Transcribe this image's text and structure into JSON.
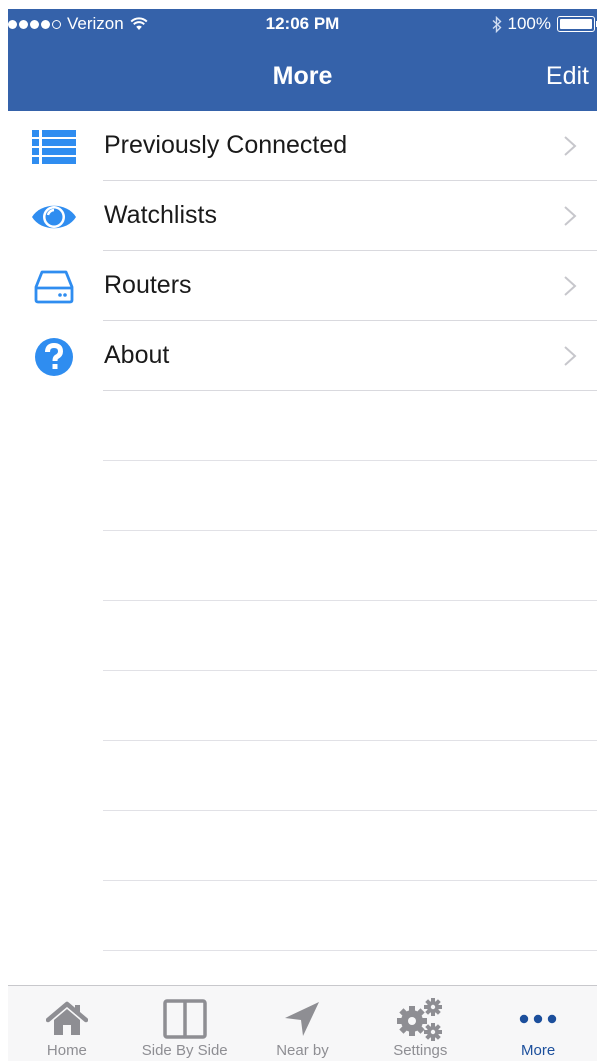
{
  "status_bar": {
    "carrier": "Verizon",
    "time": "12:06 PM",
    "battery": "100%"
  },
  "nav": {
    "title": "More",
    "edit_label": "Edit"
  },
  "menu": {
    "items": [
      {
        "label": "Previously Connected",
        "icon": "list-icon"
      },
      {
        "label": "Watchlists",
        "icon": "eye-icon"
      },
      {
        "label": "Routers",
        "icon": "router-icon"
      },
      {
        "label": "About",
        "icon": "question-icon"
      }
    ]
  },
  "tabbar": {
    "tabs": [
      {
        "label": "Home",
        "icon": "house-icon"
      },
      {
        "label": "Side By Side",
        "icon": "split-view-icon"
      },
      {
        "label": "Near by",
        "icon": "location-arrow-icon"
      },
      {
        "label": "Settings",
        "icon": "gears-icon"
      },
      {
        "label": "More",
        "icon": "ellipsis-icon",
        "active": true
      }
    ]
  },
  "colors": {
    "header_bg": "#3562aa",
    "accent_blue": "#2f8df0",
    "active_tab": "#1c4f9c",
    "inactive_tab": "#8e8e93"
  }
}
